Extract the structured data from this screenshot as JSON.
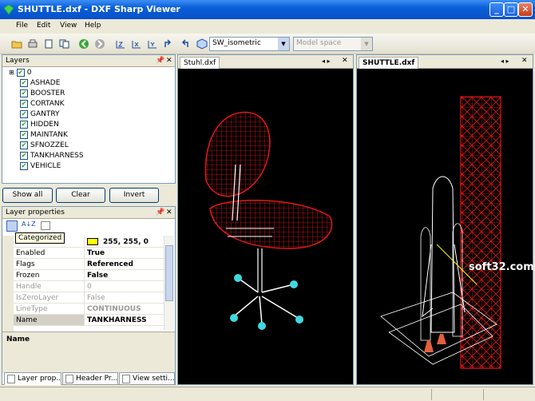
{
  "window": {
    "title": "SHUTTLE.dxf - DXF Sharp Viewer",
    "min": "_",
    "max": "□",
    "close": "✕"
  },
  "menu": [
    "File",
    "Edit",
    "View",
    "Help"
  ],
  "toolbar": {
    "view_select": "SW_isometric",
    "space_select": "Model space"
  },
  "layers": {
    "title": "Layers",
    "root": "0",
    "items": [
      "ASHADE",
      "BOOSTER",
      "CORTANK",
      "GANTRY",
      "HIDDEN",
      "MAINTANK",
      "SFNOZZEL",
      "TANKHARNESS",
      "VEHICLE"
    ]
  },
  "buttons": {
    "show_all": "Show all",
    "clear": "Clear",
    "invert": "Invert"
  },
  "layer_props": {
    "title": "Layer properties",
    "tooltip": "Categorized",
    "color_value": "255, 255, 0",
    "rows": [
      {
        "k": "Enabled",
        "v": "True",
        "disabled": false
      },
      {
        "k": "Flags",
        "v": "Referenced",
        "disabled": false
      },
      {
        "k": "Frozen",
        "v": "False",
        "disabled": false
      },
      {
        "k": "Handle",
        "v": "0",
        "disabled": true
      },
      {
        "k": "IsZeroLayer",
        "v": "False",
        "disabled": true
      },
      {
        "k": "LineType",
        "v": "CONTINUOUS",
        "disabled": true
      },
      {
        "k": "Name",
        "v": "TANKHARNESS",
        "disabled": false
      }
    ],
    "desc_title": "Name"
  },
  "bottom_tabs": [
    "Layer prop...",
    "Header Pr...",
    "View setti..."
  ],
  "docs": [
    {
      "tab": "Stuhl.dxf"
    },
    {
      "tab": "SHUTTLE.dxf"
    }
  ],
  "watermark": "soft32.com",
  "colors": {
    "wire_red": "#e01818",
    "wire_white": "#ffffff",
    "cyan": "#40d8e0",
    "title_blue": "#0a5fd8"
  }
}
